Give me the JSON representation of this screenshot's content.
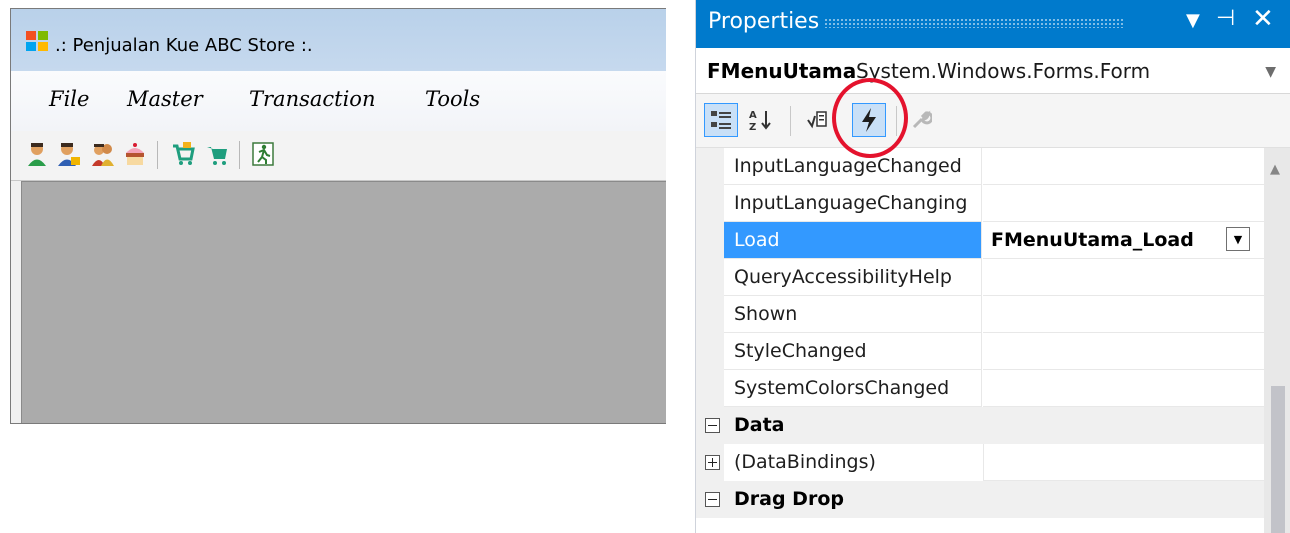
{
  "app": {
    "title": ".: Penjualan Kue ABC Store :.",
    "menu": [
      "File",
      "Master",
      "Transaction",
      "Tools"
    ],
    "toolbar_icons": [
      "user-icon",
      "user-cashier-icon",
      "users-group-icon",
      "cake-icon",
      "cart-add-icon",
      "cart-icon",
      "exit-running-icon"
    ]
  },
  "properties": {
    "title": "Properties",
    "object_name": "FMenuUtama",
    "object_type": "System.Windows.Forms.Form",
    "toolbar": [
      "categorized-icon",
      "alphabetical-icon",
      "properties-icon",
      "events-icon",
      "property-pages-icon"
    ],
    "active_toolbar_button": "events",
    "rows": [
      {
        "name": "InputLanguageChanged",
        "value": ""
      },
      {
        "name": "InputLanguageChanging",
        "value": ""
      },
      {
        "name": "Load",
        "value": "FMenuUtama_Load"
      },
      {
        "name": "QueryAccessibilityHelp",
        "value": ""
      },
      {
        "name": "Shown",
        "value": ""
      },
      {
        "name": "StyleChanged",
        "value": ""
      },
      {
        "name": "SystemColorsChanged",
        "value": ""
      }
    ],
    "categories": [
      {
        "label": "Data",
        "expanded": true
      },
      {
        "label": "(DataBindings)",
        "expanded": false
      },
      {
        "label": "Drag Drop",
        "expanded": true
      }
    ],
    "colors": {
      "title_bg": "#007acc",
      "selection": "#3399ff",
      "highlight_circle": "#e4122d"
    }
  }
}
